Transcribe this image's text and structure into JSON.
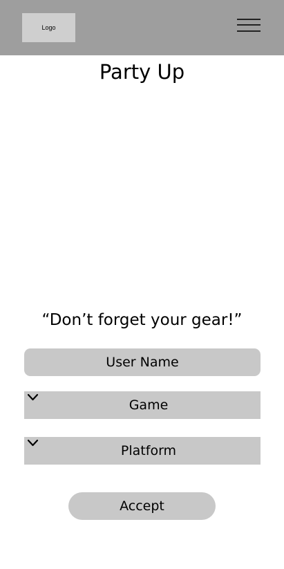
{
  "header": {
    "logo_text": "Logo",
    "menu_icon": "hamburger-menu-icon",
    "background": "#9e9e9e"
  },
  "title": "Party Up",
  "quote": "“Don’t forget your gear!”",
  "form": {
    "username_placeholder": "User Name",
    "game_select": {
      "label": "Game",
      "icon": "chevron-down-icon"
    },
    "platform_select": {
      "label": "Platform",
      "icon": "chevron-down-icon"
    },
    "accept_label": "Accept",
    "control_color": "#c8c8c8"
  }
}
